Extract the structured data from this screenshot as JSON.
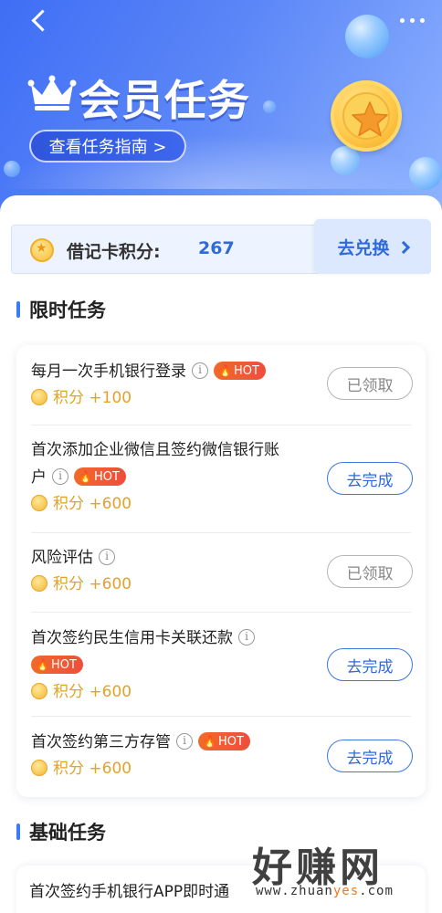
{
  "header": {
    "title": "会员任务",
    "guide_button": "查看任务指南 >",
    "icons": {
      "back": "back-arrow-icon",
      "more": "more-dots-icon",
      "crown": "crown-icon",
      "coin": "star-coin-icon"
    }
  },
  "points": {
    "label": "借记卡积分:",
    "value": "267",
    "redeem_button": "去兑换"
  },
  "limited_section": {
    "title": "限时任务",
    "tasks": [
      {
        "name": "每月一次手机银行登录",
        "hot": "HOT",
        "reward": "积分 +100",
        "button": "已领取",
        "status": "claimed"
      },
      {
        "name_line1": "首次添加企业微信且签约微信银行账",
        "name_line2": "户",
        "hot": "HOT",
        "reward": "积分 +600",
        "button": "去完成",
        "status": "todo"
      },
      {
        "name": "风险评估",
        "reward": "积分 +600",
        "button": "已领取",
        "status": "claimed"
      },
      {
        "name": "首次签约民生信用卡关联还款",
        "hot": "HOT",
        "reward": "积分 +600",
        "button": "去完成",
        "status": "todo"
      },
      {
        "name": "首次签约第三方存管",
        "hot": "HOT",
        "reward": "积分 +600",
        "button": "去完成",
        "status": "todo"
      }
    ]
  },
  "basic_section": {
    "title": "基础任务",
    "first_task": "首次签约手机银行APP即时通"
  },
  "watermark": {
    "text": "好赚网",
    "url_pre": "www.zhuan",
    "url_hl": "yes",
    "url_post": ".com"
  },
  "colors": {
    "accent": "#2f6bd8",
    "header_gradient": "#3f6ef5",
    "reward": "#e2a326",
    "hot": "#f04d3c"
  }
}
